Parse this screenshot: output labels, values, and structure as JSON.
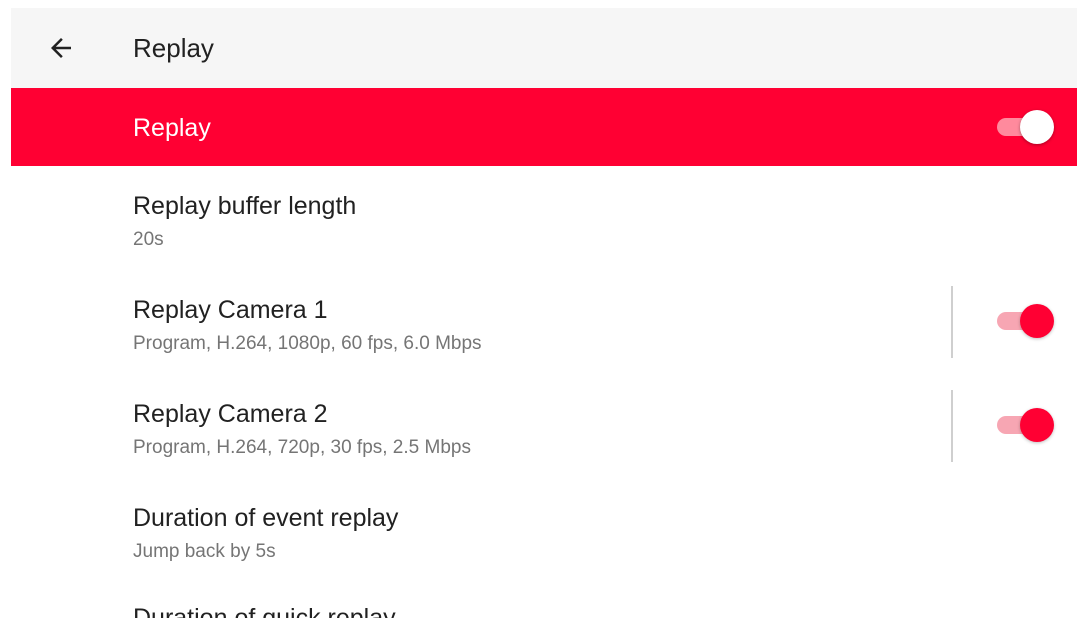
{
  "appbar": {
    "title": "Replay",
    "back_icon": "arrow-back-icon"
  },
  "master_switch": {
    "label": "Replay",
    "enabled": true
  },
  "settings": [
    {
      "title": "Replay buffer length",
      "summary": "20s"
    },
    {
      "title": "Replay Camera 1",
      "summary": "Program, H.264, 1080p, 60 fps, 6.0 Mbps",
      "enabled": true
    },
    {
      "title": "Replay Camera 2",
      "summary": "Program, H.264, 720p, 30 fps, 2.5 Mbps",
      "enabled": true
    },
    {
      "title": "Duration of event replay",
      "summary": "Jump back by 5s"
    },
    {
      "title": "Duration of quick replay"
    }
  ],
  "colors": {
    "accent": "#ff0033",
    "appbar_bg": "#f6f6f6",
    "title_text": "#212121",
    "summary_text": "#757575"
  }
}
